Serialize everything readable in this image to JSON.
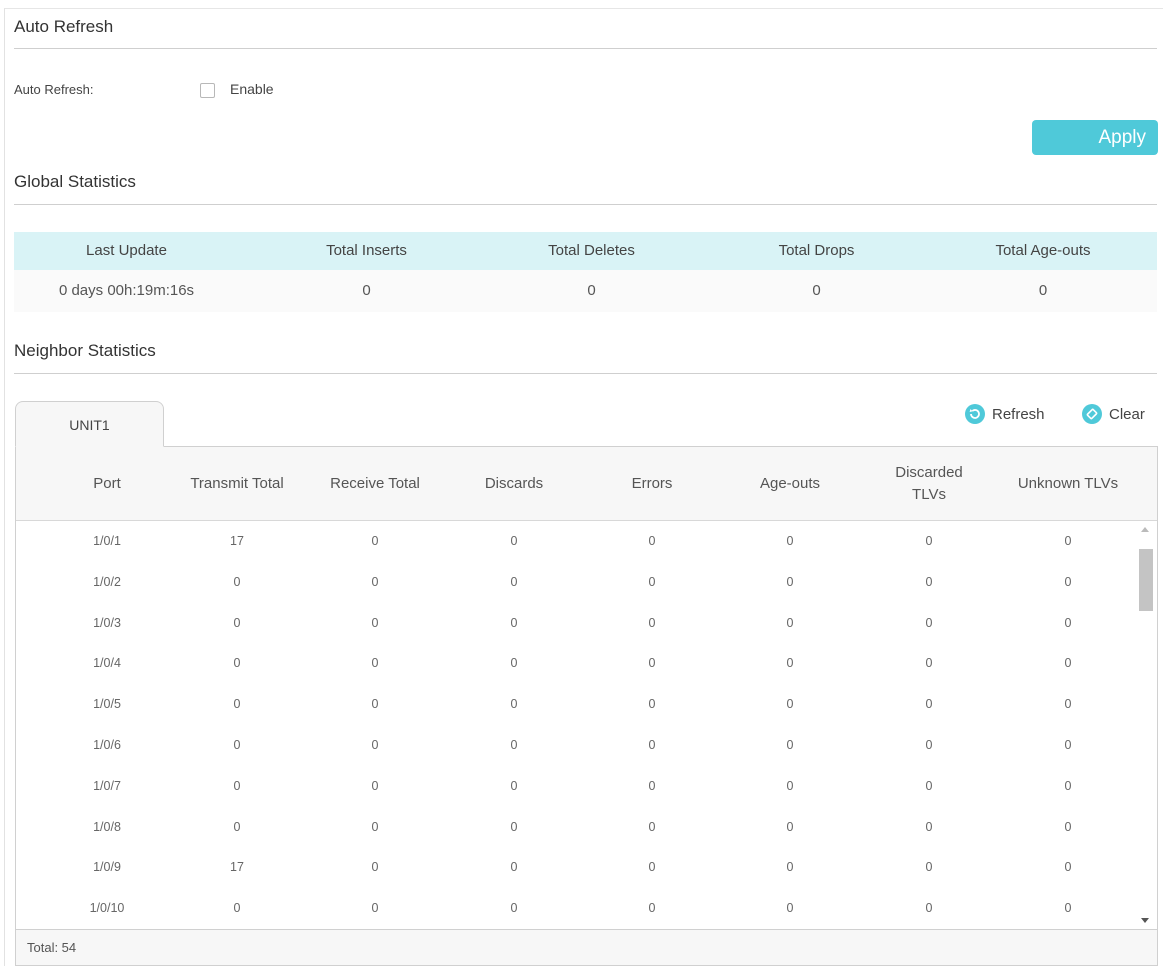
{
  "auto_refresh": {
    "section_title": "Auto Refresh",
    "label": "Auto Refresh:",
    "enable_label": "Enable",
    "apply_label": "Apply"
  },
  "global_stats": {
    "section_title": "Global Statistics",
    "headers": [
      "Last Update",
      "Total Inserts",
      "Total Deletes",
      "Total Drops",
      "Total Age-outs"
    ],
    "values": [
      "0 days 00h:19m:16s",
      "0",
      "0",
      "0",
      "0"
    ]
  },
  "neighbor_stats": {
    "section_title": "Neighbor Statistics",
    "tab_label": "UNIT1",
    "refresh_label": "Refresh",
    "clear_label": "Clear",
    "headers": [
      "Port",
      "Transmit Total",
      "Receive Total",
      "Discards",
      "Errors",
      "Age-outs",
      "Discarded\nTLVs",
      "Unknown TLVs"
    ],
    "rows": [
      [
        "1/0/1",
        "17",
        "0",
        "0",
        "0",
        "0",
        "0",
        "0"
      ],
      [
        "1/0/2",
        "0",
        "0",
        "0",
        "0",
        "0",
        "0",
        "0"
      ],
      [
        "1/0/3",
        "0",
        "0",
        "0",
        "0",
        "0",
        "0",
        "0"
      ],
      [
        "1/0/4",
        "0",
        "0",
        "0",
        "0",
        "0",
        "0",
        "0"
      ],
      [
        "1/0/5",
        "0",
        "0",
        "0",
        "0",
        "0",
        "0",
        "0"
      ],
      [
        "1/0/6",
        "0",
        "0",
        "0",
        "0",
        "0",
        "0",
        "0"
      ],
      [
        "1/0/7",
        "0",
        "0",
        "0",
        "0",
        "0",
        "0",
        "0"
      ],
      [
        "1/0/8",
        "0",
        "0",
        "0",
        "0",
        "0",
        "0",
        "0"
      ],
      [
        "1/0/9",
        "17",
        "0",
        "0",
        "0",
        "0",
        "0",
        "0"
      ],
      [
        "1/0/10",
        "0",
        "0",
        "0",
        "0",
        "0",
        "0",
        "0"
      ]
    ],
    "total_label": "Total: 54"
  },
  "colors": {
    "accent": "#4fc9d9",
    "header_bg": "#d9f3f6"
  }
}
